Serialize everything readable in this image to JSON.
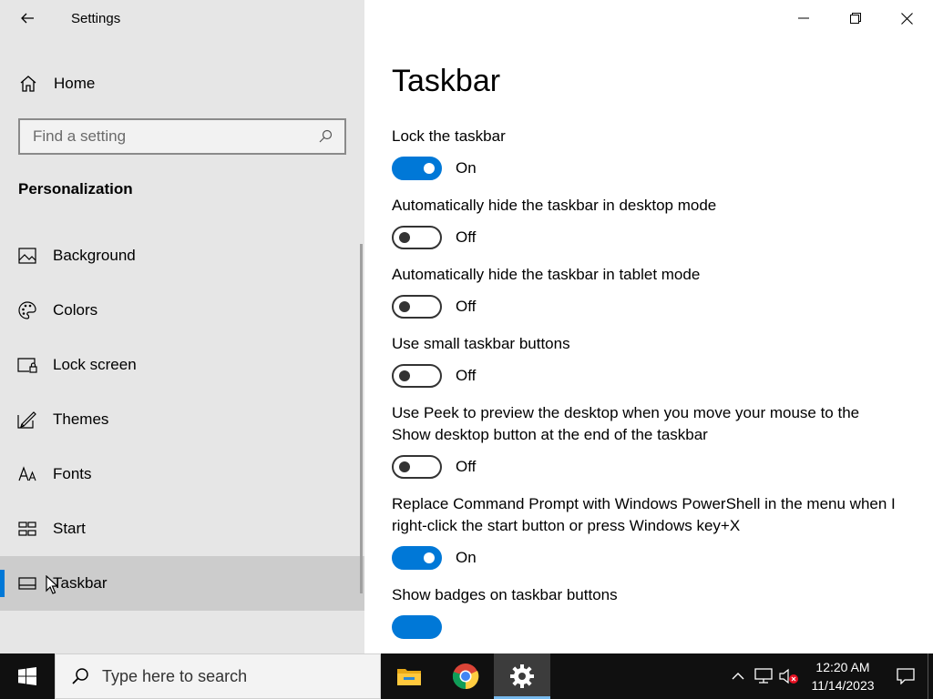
{
  "window": {
    "app_title": "Settings",
    "icons": {
      "back": "back-arrow-icon",
      "minimize": "minimize-icon",
      "restore": "restore-icon",
      "close": "close-icon"
    }
  },
  "sidebar": {
    "home_label": "Home",
    "search_placeholder": "Find a setting",
    "section_title": "Personalization",
    "items": [
      {
        "label": "Background",
        "icon": "picture-icon",
        "active": false
      },
      {
        "label": "Colors",
        "icon": "palette-icon",
        "active": false
      },
      {
        "label": "Lock screen",
        "icon": "lock-screen-icon",
        "active": false
      },
      {
        "label": "Themes",
        "icon": "themes-icon",
        "active": false
      },
      {
        "label": "Fonts",
        "icon": "fonts-icon",
        "active": false
      },
      {
        "label": "Start",
        "icon": "start-tiles-icon",
        "active": false
      },
      {
        "label": "Taskbar",
        "icon": "taskbar-icon",
        "active": true
      }
    ]
  },
  "main": {
    "title": "Taskbar",
    "settings": [
      {
        "label": "Lock the taskbar",
        "state": "On"
      },
      {
        "label": "Automatically hide the taskbar in desktop mode",
        "state": "Off"
      },
      {
        "label": "Automatically hide the taskbar in tablet mode",
        "state": "Off"
      },
      {
        "label": "Use small taskbar buttons",
        "state": "Off"
      },
      {
        "label": "Use Peek to preview the desktop when you move your mouse to the Show desktop button at the end of the taskbar",
        "state": "Off"
      },
      {
        "label": "Replace Command Prompt with Windows PowerShell in the menu when I right-click the start button or press Windows key+X",
        "state": "On"
      }
    ],
    "partial_setting": {
      "label": "Show badges on taskbar buttons"
    }
  },
  "taskbar": {
    "search_text": "Type here to search",
    "apps": [
      {
        "name": "File Explorer",
        "icon": "file-explorer-icon",
        "active": false
      },
      {
        "name": "Google Chrome",
        "icon": "chrome-icon",
        "active": false
      },
      {
        "name": "Settings",
        "icon": "settings-gear-icon",
        "active": true
      }
    ],
    "clock": {
      "time": "12:20 AM",
      "date": "11/14/2023"
    },
    "colors": {
      "accent": "#0078d7",
      "taskbar_bg": "#101010"
    }
  }
}
